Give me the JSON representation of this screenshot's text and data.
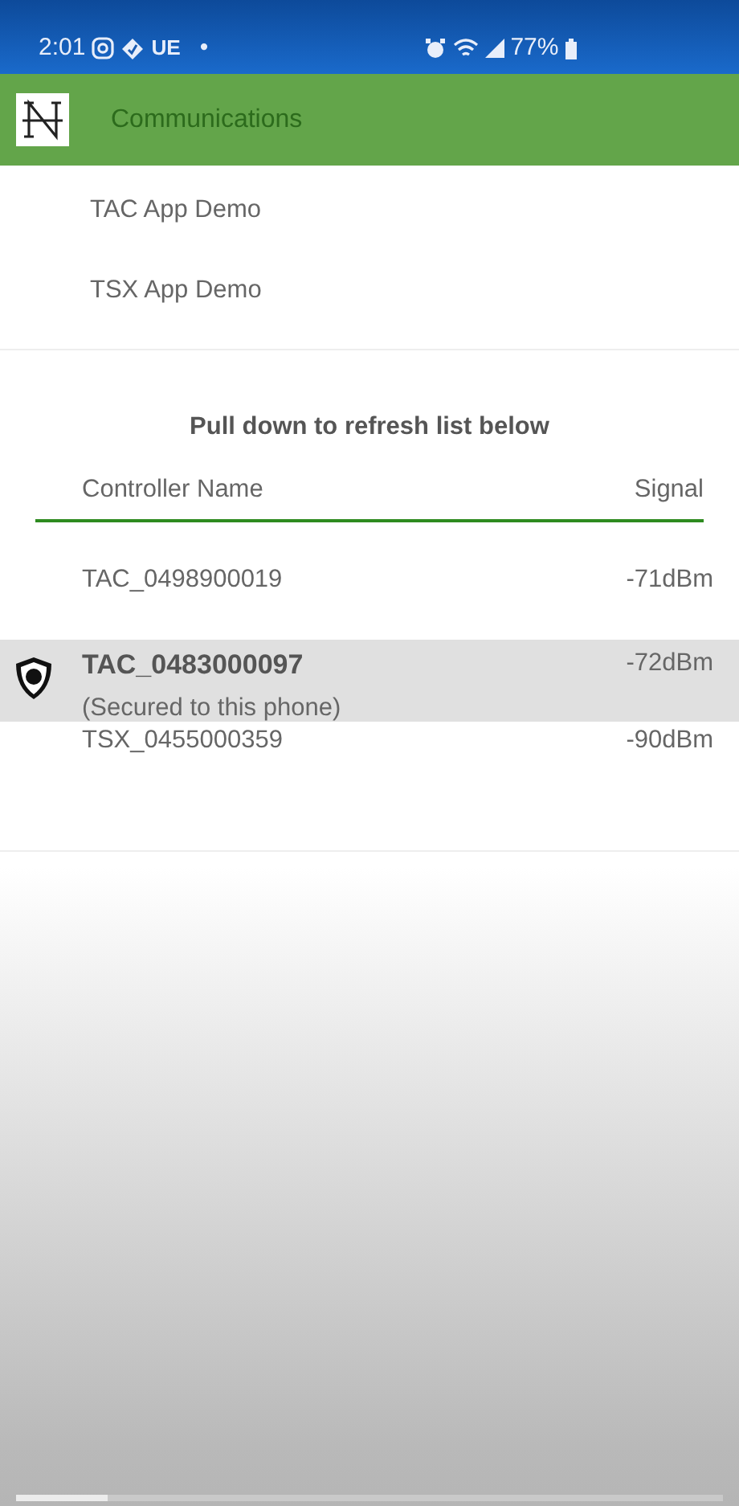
{
  "status_bar": {
    "time": "2:01",
    "carrier": "UE",
    "dot": "•",
    "battery": "77%"
  },
  "app_bar": {
    "title": "Communications"
  },
  "menu_items": [
    {
      "label": "TAC App Demo"
    },
    {
      "label": "TSX App Demo"
    }
  ],
  "refresh_hint": "Pull down to refresh list below",
  "table": {
    "columns": [
      "Controller Name",
      "Signal"
    ],
    "rows": [
      {
        "name": "TAC_0498900019",
        "signal": "-71dBm",
        "selected": false,
        "secured": false
      },
      {
        "name": "TAC_0483000097",
        "subtitle": "(Secured to this phone)",
        "signal": "-72dBm",
        "selected": true,
        "secured": true
      },
      {
        "name": "TSX_0455000359",
        "signal": "-90dBm",
        "selected": false,
        "secured": false
      }
    ]
  },
  "video_progress": {
    "level": 0.13
  }
}
